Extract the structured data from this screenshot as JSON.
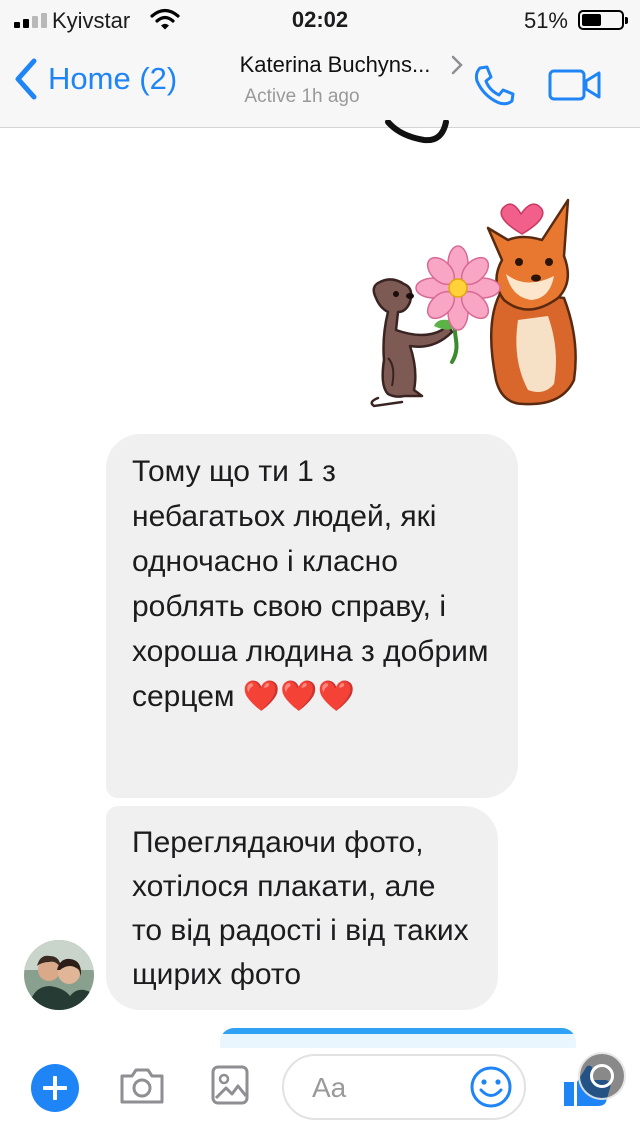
{
  "status_bar": {
    "carrier": "Kyivstar",
    "time": "02:02",
    "battery_percent": "51%",
    "battery_level": 0.51,
    "signal_bars_total": 4,
    "signal_bars_active": 2
  },
  "header": {
    "back_label": "Home (2)",
    "contact_name": "Katerina Buchyns...",
    "contact_status": "Active 1h ago",
    "icons": [
      "chevron-left-icon",
      "chevron-right-icon",
      "phone-icon",
      "video-camera-icon"
    ],
    "accent_color": "#1f85f7"
  },
  "messages": [
    {
      "type": "sticker",
      "description_icon": "dog-and-fox-with-flower-sticker"
    },
    {
      "type": "text",
      "sender": "contact",
      "text": "Тому що ти 1 з небагатьох людей, які одночасно і класно роблять свою справу, і хороша людина з добрим серцем ❤️❤️❤️"
    },
    {
      "type": "text",
      "sender": "contact",
      "text": "Переглядаючи фото, хотілося плакати, але то від радості і від таких щирих фото"
    }
  ],
  "composer": {
    "placeholder": "Aa",
    "icons": [
      "plus-icon",
      "camera-icon",
      "gallery-icon",
      "emoji-icon",
      "thumbs-up-icon"
    ]
  },
  "colors": {
    "bubble_incoming": "#f1f0f0",
    "bubble_outgoing": "#2fa2f5"
  }
}
